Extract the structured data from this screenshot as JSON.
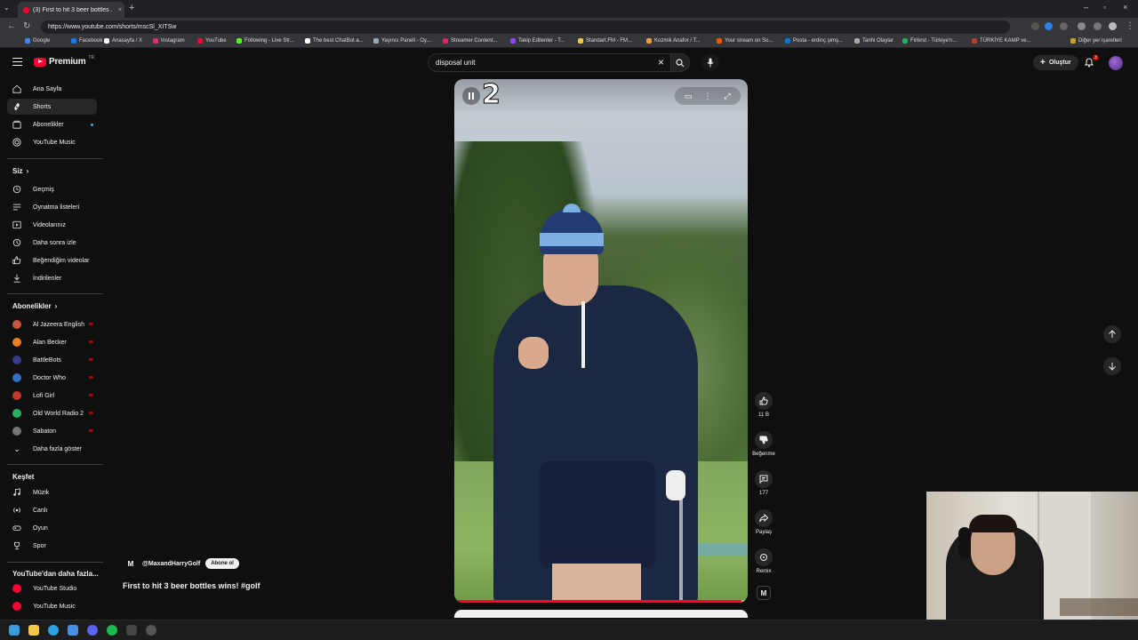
{
  "browser": {
    "tab_title": "(3) First to hit 3 beer bottles ...",
    "url": "https://www.youtube.com/shorts/mscSl_XITSw",
    "bookmarks": [
      {
        "label": "Google",
        "color": "#4285f4"
      },
      {
        "label": "Facebook",
        "color": "#1877f2"
      },
      {
        "label": "Anasayfa / X",
        "color": "#ffffff"
      },
      {
        "label": "Instagram",
        "color": "#e1306c"
      },
      {
        "label": "YouTube",
        "color": "#ff0033"
      },
      {
        "label": "Following - Live Str...",
        "color": "#53fc18"
      },
      {
        "label": "The best ChatBot a...",
        "color": "#ffffff"
      },
      {
        "label": "Yayıncı Paneli - Oy...",
        "color": "#9ab"
      },
      {
        "label": "Streamer Content...",
        "color": "#e91e63"
      },
      {
        "label": "Takip Edilenler - T...",
        "color": "#9146ff"
      },
      {
        "label": "Standart.FM - FM...",
        "color": "#f2c94c"
      },
      {
        "label": "Kozmik Anafor / T...",
        "color": "#f2994a"
      },
      {
        "label": "Your stream on So...",
        "color": "#ff5500"
      },
      {
        "label": "Posta - erdinç şimş...",
        "color": "#0078d4"
      },
      {
        "label": "Tarihi Olaylar",
        "color": "#aaa"
      },
      {
        "label": "Firikrst - Türkiye'n...",
        "color": "#27ae60"
      },
      {
        "label": "TÜRKİYE KAMP ve...",
        "color": "#c0392b"
      }
    ],
    "other_bookmarks": "Diğer yer işaretleri"
  },
  "header": {
    "logo_text": "Premium",
    "logo_country": "TR",
    "search_value": "disposal unit",
    "create_label": "Oluştur",
    "notif_count": "3"
  },
  "sidebar": {
    "main": [
      {
        "label": "Ana Sayfa",
        "icon": "home-icon"
      },
      {
        "label": "Shorts",
        "icon": "shorts-icon",
        "active": true
      },
      {
        "label": "Abonelikler",
        "icon": "subscriptions-icon"
      },
      {
        "label": "YouTube Music",
        "icon": "music-icon"
      }
    ],
    "you_heading": "Siz",
    "you": [
      {
        "label": "Geçmiş",
        "icon": "history-icon"
      },
      {
        "label": "Oynatma listeleri",
        "icon": "playlist-icon"
      },
      {
        "label": "Videolarınız",
        "icon": "your-videos-icon"
      },
      {
        "label": "Daha sonra izle",
        "icon": "watch-later-icon"
      },
      {
        "label": "Beğendiğim videolar",
        "icon": "liked-icon"
      },
      {
        "label": "İndirilenler",
        "icon": "download-icon"
      }
    ],
    "subs_heading": "Abonelikler",
    "subs": [
      {
        "label": "Al Jazeera English",
        "color": "#c8553d"
      },
      {
        "label": "Alan Becker",
        "color": "#e67e22"
      },
      {
        "label": "BattleBots",
        "color": "#3a3a8a"
      },
      {
        "label": "Doctor Who",
        "color": "#2f6fc2"
      },
      {
        "label": "Lofi Girl",
        "color": "#c0392b"
      },
      {
        "label": "Old World Radio 2",
        "color": "#27ae60"
      },
      {
        "label": "Sabaton",
        "color": "#777777"
      }
    ],
    "show_more": "Daha fazla göster",
    "explore_heading": "Keşfet",
    "explore": [
      {
        "label": "Müzik",
        "icon": "music-note-icon"
      },
      {
        "label": "Canlı",
        "icon": "live-icon"
      },
      {
        "label": "Oyun",
        "icon": "gaming-icon"
      },
      {
        "label": "Spor",
        "icon": "trophy-icon"
      }
    ],
    "more_heading": "YouTube'dan daha fazla...",
    "more": [
      {
        "label": "YouTube Studio",
        "color": "#ff0033"
      },
      {
        "label": "YouTube Music",
        "color": "#ff0033"
      }
    ]
  },
  "video": {
    "overlay_text": "2",
    "progress": 0.98,
    "channel_handle": "@MaxandHarryGolf",
    "channel_logo": "M",
    "subscribe_label": "Abone ol",
    "title": "First to hit 3 beer bottles wins! #golf"
  },
  "actions": {
    "likes": "11 B",
    "dislike_label": "Beğenme",
    "comments": "177",
    "share_label": "Paylaş",
    "remix_label": "Remix"
  }
}
